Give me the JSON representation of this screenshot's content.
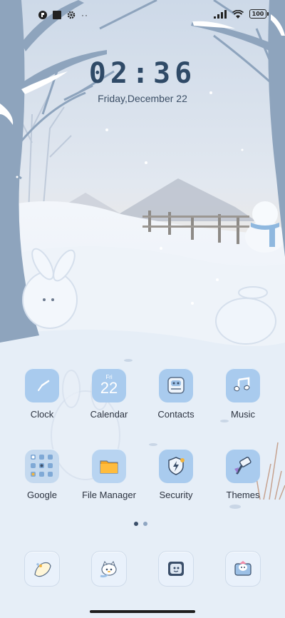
{
  "status_bar": {
    "left_icons": [
      "app-badge-icon",
      "square-icon",
      "gear-icon"
    ],
    "more": "··",
    "battery": "100",
    "right_icons": [
      "signal-icon",
      "wifi-icon",
      "battery-icon"
    ]
  },
  "lockclock": {
    "time": "02:36",
    "date": "Friday,December 22"
  },
  "apps": [
    {
      "label": "Clock",
      "icon": "clock-icon"
    },
    {
      "label": "Calendar",
      "icon": "calendar-icon",
      "weekday": "Fri",
      "day": "22"
    },
    {
      "label": "Contacts",
      "icon": "contacts-icon"
    },
    {
      "label": "Music",
      "icon": "music-icon"
    },
    {
      "label": "Google",
      "icon": "google-folder-icon"
    },
    {
      "label": "File Manager",
      "icon": "folder-icon"
    },
    {
      "label": "Security",
      "icon": "shield-icon"
    },
    {
      "label": "Themes",
      "icon": "paintbrush-icon"
    }
  ],
  "dock": [
    {
      "icon": "phone-icon"
    },
    {
      "icon": "messages-icon"
    },
    {
      "icon": "camera-icon"
    },
    {
      "icon": "gallery-icon"
    }
  ],
  "pages": {
    "count": 2,
    "active": 0
  }
}
